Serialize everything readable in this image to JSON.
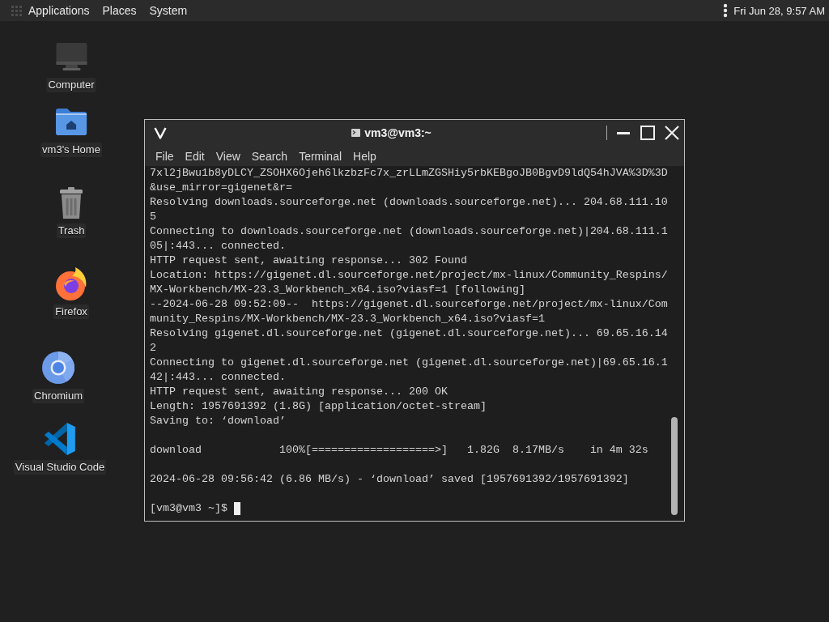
{
  "top_panel": {
    "menus": [
      "Applications",
      "Places",
      "System"
    ],
    "clock": "Fri Jun 28, 9:57 AM"
  },
  "desktop_icons": [
    {
      "kind": "computer",
      "label": "Computer"
    },
    {
      "kind": "home",
      "label": "vm3's Home"
    },
    {
      "kind": "trash",
      "label": "Trash"
    },
    {
      "kind": "firefox",
      "label": "Firefox"
    },
    {
      "kind": "chromium",
      "label": "Chromium"
    },
    {
      "kind": "vscode",
      "label": "Visual Studio Code"
    }
  ],
  "window": {
    "title": "vm3@vm3:~",
    "menu": [
      "File",
      "Edit",
      "View",
      "Search",
      "Terminal",
      "Help"
    ],
    "terminal": {
      "blocks": [
        [
          "7xl2jBwu1b8yDLCY_ZSOHX6Ojeh6lkzbzFc7x_zrLLmZGSHiy5rbKEBgoJB0BgvD9ldQ54hJVA%3D%3D",
          "&use_mirror=gigenet&r=",
          "Resolving downloads.sourceforge.net (downloads.sourceforge.net)... 204.68.111.10",
          "5",
          "Connecting to downloads.sourceforge.net (downloads.sourceforge.net)|204.68.111.1",
          "05|:443... connected.",
          "HTTP request sent, awaiting response... 302 Found",
          "Location: https://gigenet.dl.sourceforge.net/project/mx-linux/Community_Respins/",
          "MX-Workbench/MX-23.3_Workbench_x64.iso?viasf=1 [following]",
          "--2024-06-28 09:52:09--  https://gigenet.dl.sourceforge.net/project/mx-linux/Com",
          "munity_Respins/MX-Workbench/MX-23.3_Workbench_x64.iso?viasf=1",
          "Resolving gigenet.dl.sourceforge.net (gigenet.dl.sourceforge.net)... 69.65.16.14",
          "2",
          "Connecting to gigenet.dl.sourceforge.net (gigenet.dl.sourceforge.net)|69.65.16.1",
          "42|:443... connected.",
          "HTTP request sent, awaiting response... 200 OK",
          "Length: 1957691392 (1.8G) [application/octet-stream]",
          "Saving to: ‘download’"
        ],
        [
          "download            100%[===================>]   1.82G  8.17MB/s    in 4m 32s"
        ],
        [
          "2024-06-28 09:56:42 (6.86 MB/s) - ‘download’ saved [1957691392/1957691392]"
        ]
      ],
      "prompt": "[vm3@vm3 ~]$"
    }
  }
}
